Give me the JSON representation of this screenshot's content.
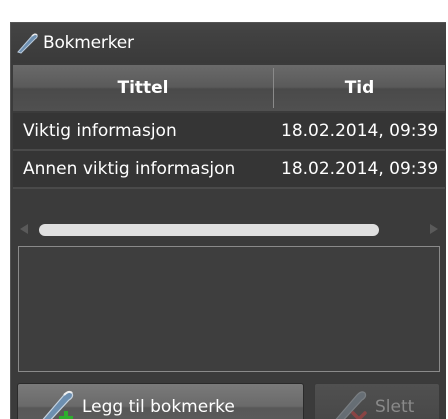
{
  "panel": {
    "title": "Bokmerker",
    "title_icon": "bookmark-ribbon-icon"
  },
  "table": {
    "columns": [
      "Tittel",
      "Tid"
    ],
    "rows": [
      {
        "title": "Viktig informasjon",
        "time": "18.02.2014, 09:39"
      },
      {
        "title": "Annen viktig informasjon",
        "time": "18.02.2014, 09:39"
      }
    ]
  },
  "scrollbar": {
    "left_icon": "scroll-left-arrow-icon",
    "right_icon": "scroll-right-arrow-icon"
  },
  "buttons": {
    "add_label": "Legg til bokmerke",
    "add_icon": "bookmark-add-icon",
    "delete_label": "Slett",
    "delete_icon": "bookmark-delete-icon"
  },
  "colors": {
    "panel_bg": "#3b3b3b",
    "row_bg": "#353535",
    "accent_add": "#2eae2e",
    "accent_delete": "#d03030"
  }
}
